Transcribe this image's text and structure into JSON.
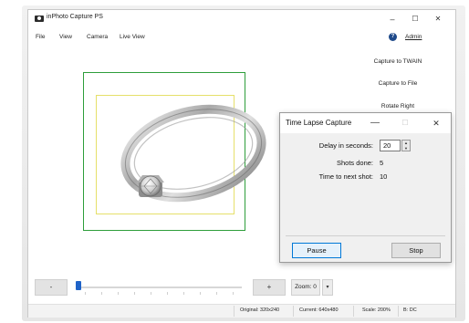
{
  "window": {
    "title": "inPhoto Capture PS",
    "minimize": "–",
    "maximize": "☐",
    "close": "✕"
  },
  "menu": {
    "items": [
      "File",
      "View",
      "Camera",
      "Live View"
    ],
    "help": "?",
    "admin": "Admin"
  },
  "right_panel": {
    "buttons": [
      "Capture to TWAIN",
      "Capture to File",
      "Rotate Right"
    ]
  },
  "bottom": {
    "minus": "-",
    "plus": "+",
    "zoom": "Zoom: 0",
    "zoom_arrow": "▾",
    "slider_value": 0
  },
  "status": {
    "original": "Original: 320x240",
    "current": "Current: 640x480",
    "scale": "Scale: 200%",
    "bdc": "B: DC"
  },
  "dialog": {
    "title": "Time Lapse Capture",
    "minimize": "—",
    "maximize": "☐",
    "close": "✕",
    "delay_label": "Delay in seconds:",
    "delay_value": "20",
    "shots_label": "Shots done:",
    "shots_value": "5",
    "next_label": "Time to next shot:",
    "next_value": "10",
    "pause": "Pause",
    "stop": "Stop"
  },
  "colors": {
    "detection_box": "#2e9e3b",
    "crop_box": "#e6e06a",
    "accent": "#0078d7"
  }
}
